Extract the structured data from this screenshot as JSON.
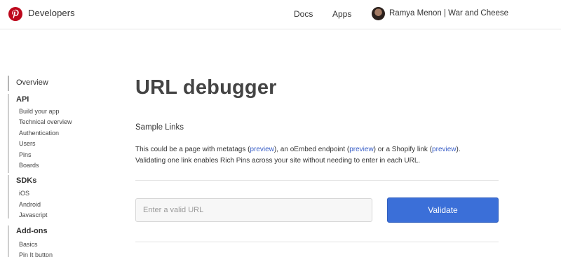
{
  "header": {
    "brand": "Developers",
    "nav": {
      "docs": "Docs",
      "apps": "Apps"
    },
    "user_name": "Ramya Menon | War and Cheese",
    "logo_icon": "pinterest-logo-icon",
    "accent_color": "#bd081c"
  },
  "sidebar": {
    "overview": "Overview",
    "api": {
      "title": "API",
      "items": [
        "Build your app",
        "Technical overview",
        "Authentication",
        "Users",
        "Pins",
        "Boards"
      ]
    },
    "sdks": {
      "title": "SDKs",
      "items": [
        "iOS",
        "Android",
        "Javascript"
      ]
    },
    "addons": {
      "title": "Add-ons",
      "items": [
        "Basics",
        "Pin It button"
      ]
    }
  },
  "main": {
    "title": "URL debugger",
    "sample_links_title": "Sample Links",
    "description": {
      "part1": "This could be a page with metatags (",
      "preview1": "preview",
      "part2": "), an oEmbed endpoint (",
      "preview2": "preview",
      "part3": ") or a Shopify link (",
      "preview3": "preview",
      "part4": ").",
      "line2": "Validating one link enables Rich Pins across your site without needing to enter in each URL."
    },
    "url_placeholder": "Enter a valid URL",
    "validate_label": "Validate",
    "button_color": "#3b6fd8",
    "link_color": "#3a5fc7"
  }
}
